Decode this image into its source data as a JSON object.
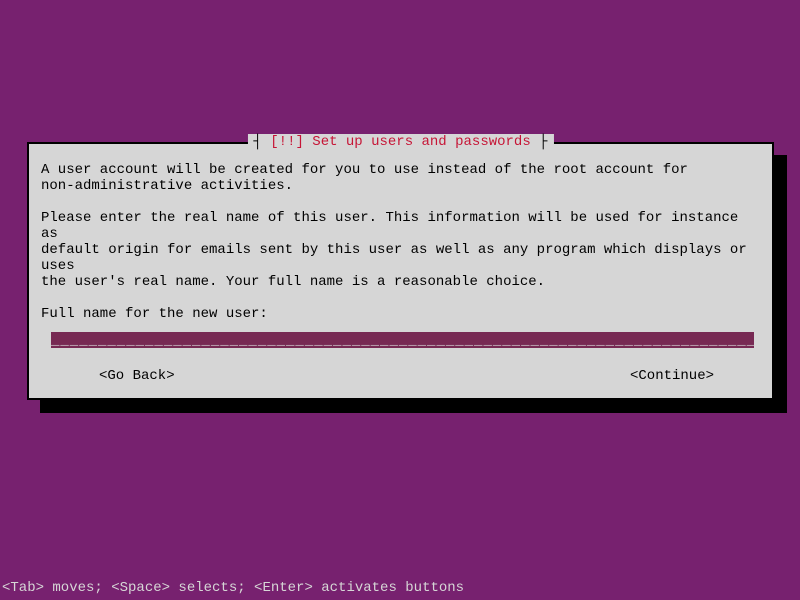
{
  "dialog": {
    "title_prefix": "┤",
    "title_marker": "[!!]",
    "title_text": "Set up users and passwords",
    "title_suffix": "├",
    "para1": "A user account will be created for you to use instead of the root account for\nnon-administrative activities.",
    "para2": "Please enter the real name of this user. This information will be used for instance as\ndefault origin for emails sent by this user as well as any program which displays or uses\nthe user's real name. Your full name is a reasonable choice.",
    "prompt": "Full name for the new user:",
    "input_value": "",
    "back_label": "<Go Back>",
    "continue_label": "<Continue>"
  },
  "footer": {
    "help_text": "<Tab> moves; <Space> selects; <Enter> activates buttons"
  }
}
